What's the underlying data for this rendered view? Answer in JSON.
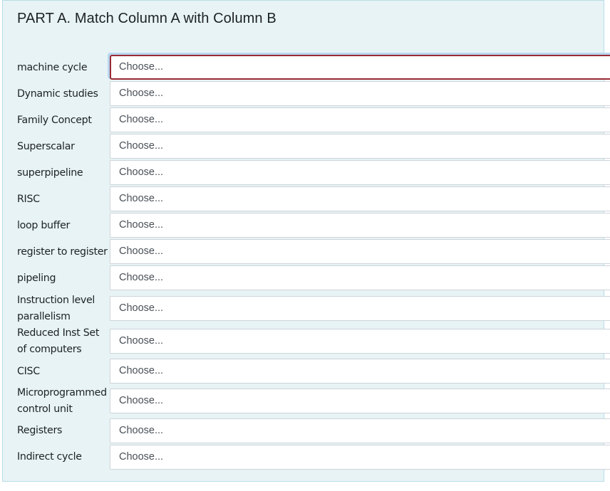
{
  "card": {
    "title": "PART A. Match Column A with Column B"
  },
  "rows": [
    {
      "label": "machine cycle",
      "select_value": "Choose...",
      "focused": true
    },
    {
      "label": "Dynamic studies",
      "select_value": "Choose..."
    },
    {
      "label": "Family Concept",
      "select_value": "Choose..."
    },
    {
      "label": "Superscalar",
      "select_value": "Choose..."
    },
    {
      "label": "superpipeline",
      "select_value": "Choose..."
    },
    {
      "label": "RISC",
      "select_value": "Choose..."
    },
    {
      "label": "loop buffer",
      "select_value": "Choose..."
    },
    {
      "label": "register to register",
      "select_value": "Choose..."
    },
    {
      "label": "pipeling",
      "select_value": "Choose..."
    },
    {
      "label": "Instruction level parallelism",
      "select_value": "Choose..."
    },
    {
      "label": "Reduced Inst Set of computers",
      "select_value": "Choose..."
    },
    {
      "label": "CISC",
      "select_value": "Choose..."
    },
    {
      "label": "Microprogrammed control unit",
      "select_value": "Choose..."
    },
    {
      "label": "Registers",
      "select_value": "Choose..."
    },
    {
      "label": "Indirect cycle",
      "select_value": "Choose..."
    }
  ]
}
